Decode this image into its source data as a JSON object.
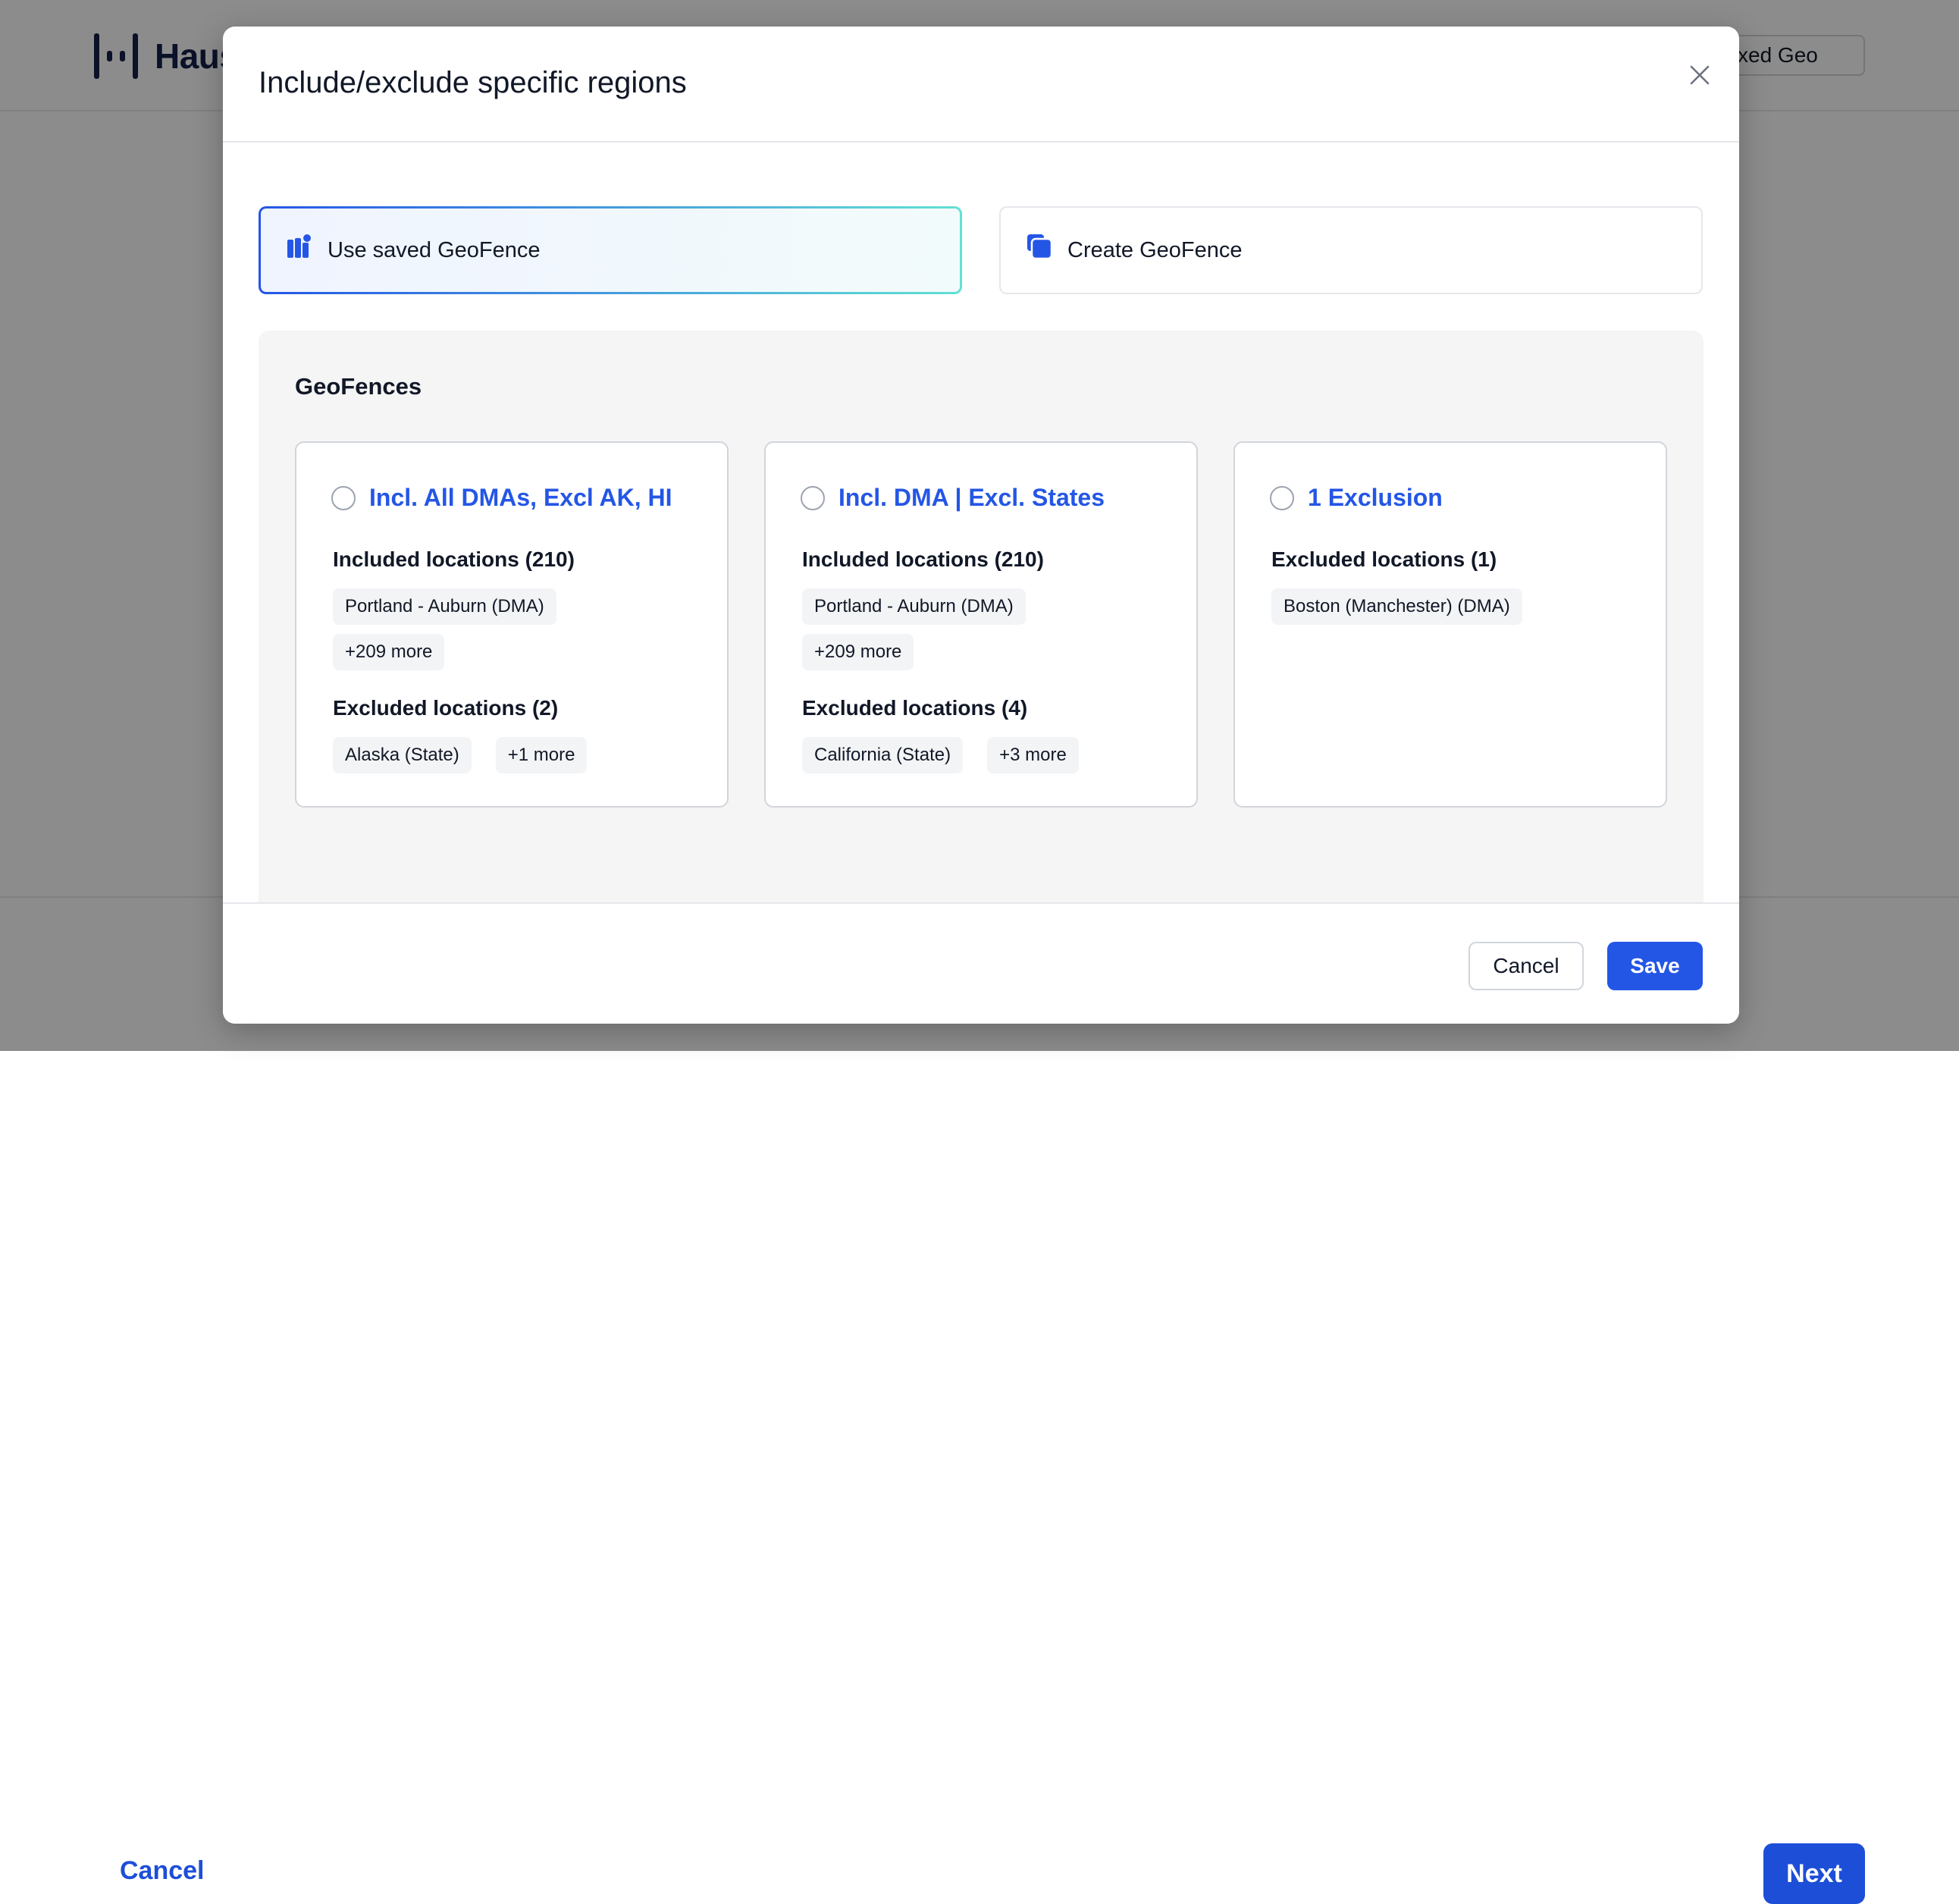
{
  "app": {
    "logo_text": "Haus",
    "header_pill": "xed Geo",
    "cancel_label": "Cancel",
    "next_label": "Next"
  },
  "modal": {
    "title": "Include/exclude specific regions",
    "options": {
      "saved_label": "Use saved GeoFence",
      "create_label": "Create GeoFence"
    },
    "panel_title": "GeoFences",
    "geofences": [
      {
        "name": "Incl. All DMAs, Excl AK, HI",
        "sections": [
          {
            "title": "Included locations (210)",
            "tags": [
              "Portland - Auburn (DMA)",
              "+209 more"
            ]
          },
          {
            "title": "Excluded locations (2)",
            "tags": [
              "Alaska (State)",
              "+1 more"
            ]
          }
        ]
      },
      {
        "name": "Incl. DMA | Excl. States",
        "sections": [
          {
            "title": "Included locations (210)",
            "tags": [
              "Portland - Auburn (DMA)",
              "+209 more"
            ]
          },
          {
            "title": "Excluded locations (4)",
            "tags": [
              "California (State)",
              "+3 more"
            ]
          }
        ]
      },
      {
        "name": "1 Exclusion",
        "sections": [
          {
            "title": "Excluded locations (1)",
            "tags": [
              "Boston (Manchester) (DMA)"
            ]
          }
        ]
      }
    ],
    "footer": {
      "cancel_label": "Cancel",
      "save_label": "Save"
    }
  },
  "colors": {
    "accent": "#2456e6",
    "brand_navy": "#13204a",
    "overlay": "rgba(0,0,0,0.45)"
  },
  "icons": [
    "close-icon",
    "saved-geofence-icon",
    "create-geofence-icon",
    "chevron-left-icon",
    "chevron-right-icon"
  ]
}
